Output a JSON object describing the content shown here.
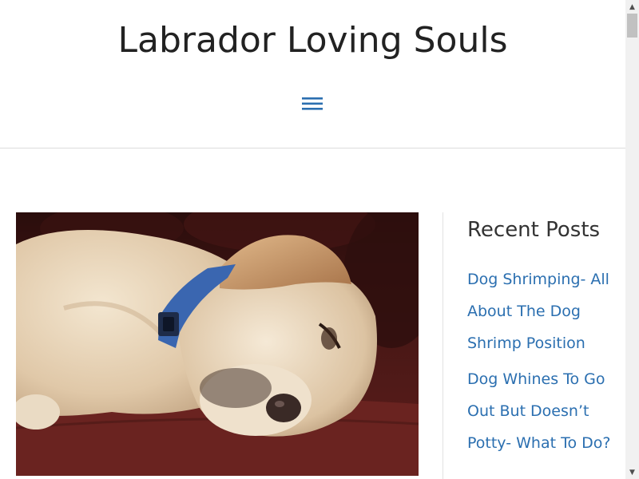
{
  "header": {
    "site_title": "Labrador Loving Souls",
    "menu_icon": "hamburger-menu-icon",
    "accent_color": "#2b6fb0"
  },
  "main": {
    "featured_image": "photo of a sleeping yellow labrador with blue collar on a dark red couch"
  },
  "sidebar": {
    "widget_title": "Recent Posts",
    "posts": [
      {
        "title": "Dog Shrimping- All About The Dog Shrimp Position"
      },
      {
        "title": "Dog Whines To Go Out But Doesn’t Potty- What To Do?"
      }
    ]
  }
}
